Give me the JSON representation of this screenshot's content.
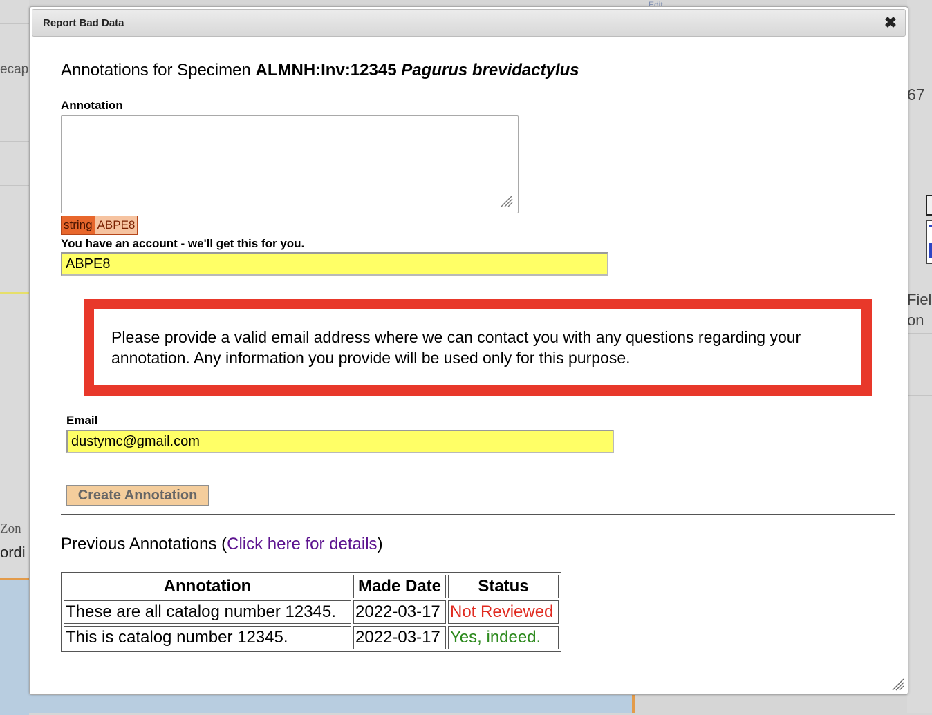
{
  "background": {
    "left_fragments": [
      "ecap",
      "Zon",
      "ordi"
    ],
    "right_fragments": [
      "67",
      "Fiel",
      "on"
    ],
    "top_fragment": "Edit"
  },
  "dialog": {
    "title": "Report Bad Data",
    "close_icon": "close-icon",
    "heading": {
      "prefix": "Annotations for Specimen",
      "catalog": "ALMNH:Inv:12345",
      "scientific_name": "Pagurus brevidactylus"
    },
    "annotation_field": {
      "label": "Annotation",
      "value": ""
    },
    "tags": {
      "type": "string",
      "value": "ABPE8"
    },
    "account": {
      "note": "You have an account - we'll get this for you.",
      "value": "ABPE8"
    },
    "notice": "Please provide a valid email address where we can contact you with any questions regarding your annotation. Any information you provide will be used only for this purpose.",
    "email": {
      "label": "Email",
      "value": "dustymc@gmail.com"
    },
    "create_button": "Create Annotation",
    "previous": {
      "label": "Previous Annotations (",
      "link": "Click here for details",
      "close_paren": ")",
      "columns": [
        "Annotation",
        "Made Date",
        "Status"
      ],
      "rows": [
        {
          "annotation": "These are all catalog number 12345.",
          "date": "2022-03-17",
          "status": "Not Reviewed",
          "status_color": "#e02a20"
        },
        {
          "annotation": "This is catalog number 12345.",
          "date": "2022-03-17",
          "status": "Yes, indeed.",
          "status_color": "#2e8a1f"
        }
      ]
    }
  }
}
